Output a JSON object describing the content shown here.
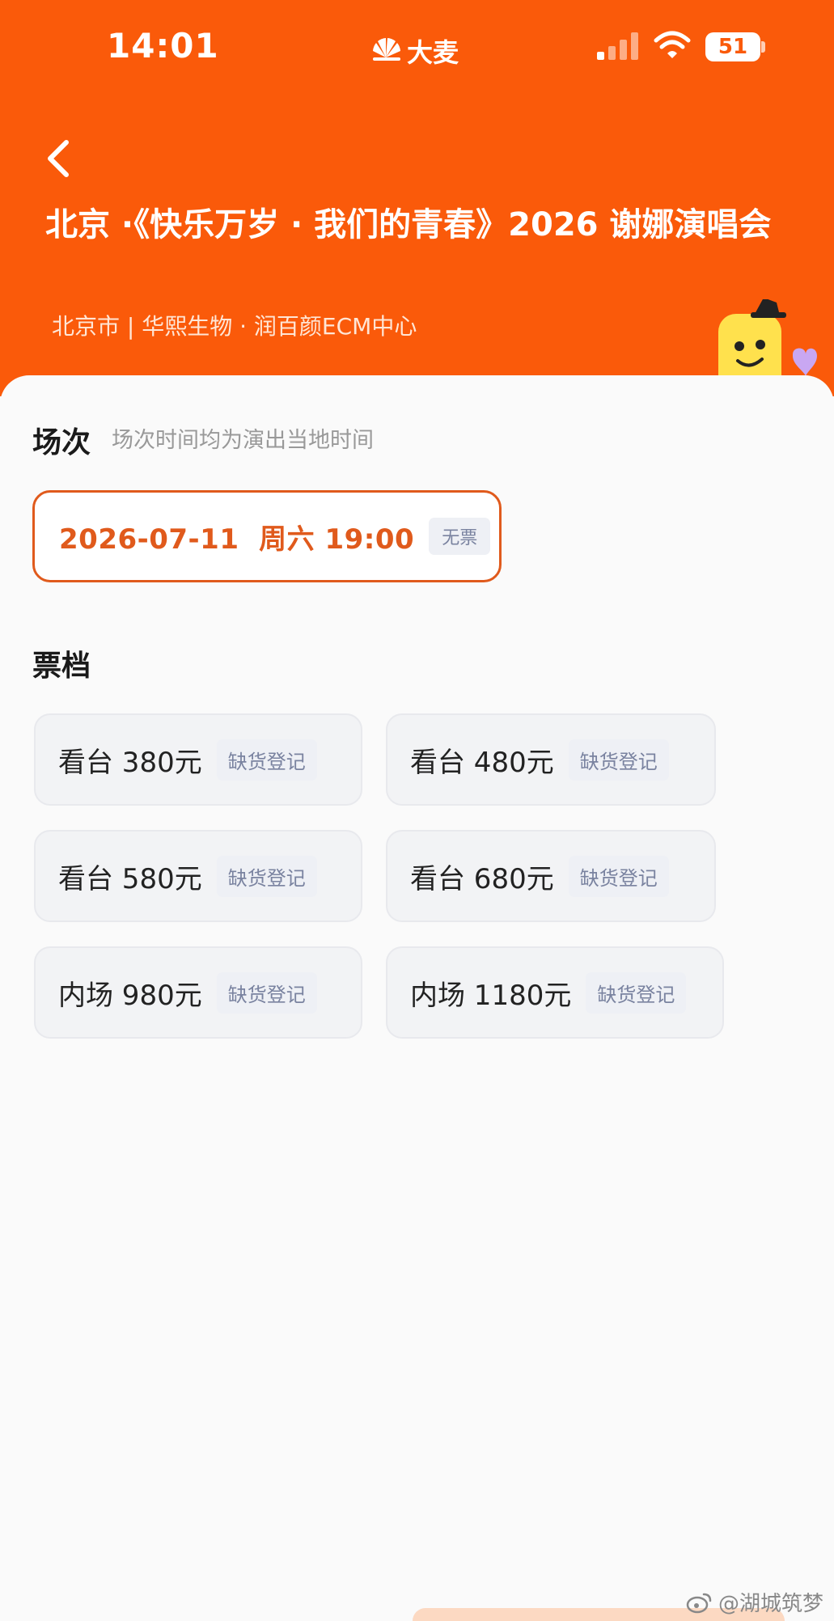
{
  "status_bar": {
    "time": "14:01",
    "brand": "大麦",
    "battery": "51"
  },
  "header": {
    "title": "北京 ·《快乐万岁 · 我们的青春》2026 谢娜演唱会",
    "venue": "北京市 | 华熙生物 · 润百颜ECM中心"
  },
  "session": {
    "heading": "场次",
    "hint": "场次时间均为演出当地时间",
    "selected": {
      "datetime": "2026-07-11  周六 19:00",
      "status": "无票"
    }
  },
  "tickets": {
    "heading": "票档",
    "items": [
      {
        "label": "看台 380元",
        "status": "缺货登记"
      },
      {
        "label": "看台 480元",
        "status": "缺货登记"
      },
      {
        "label": "看台 580元",
        "status": "缺货登记"
      },
      {
        "label": "看台 680元",
        "status": "缺货登记"
      },
      {
        "label": "内场 980元",
        "status": "缺货登记"
      },
      {
        "label": "内场 1180元",
        "status": "缺货登记"
      }
    ]
  },
  "watermark": "@湖城筑梦",
  "colors": {
    "brand_orange": "#fa5a0a",
    "selected_accent": "#e05a1c",
    "badge_text": "#7a83a0"
  },
  "icons": [
    "back-arrow-icon",
    "signal-icon",
    "wifi-icon",
    "battery-icon",
    "damai-logo-icon",
    "mascot-icon",
    "weibo-icon"
  ]
}
